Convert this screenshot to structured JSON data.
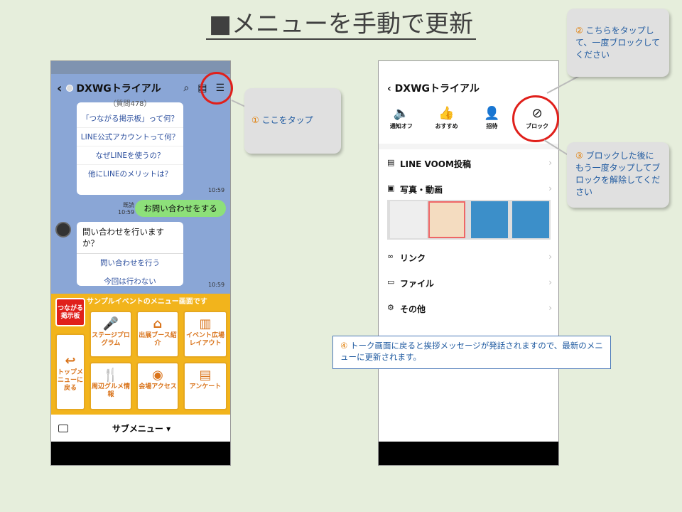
{
  "title": "■メニューを手動で更新",
  "left_phone": {
    "chat_title": "DXWGトライアル",
    "card1_cut": "（質問478）",
    "card1_items": [
      "「つながる掲示板」って何？",
      "LINE公式アカウントって何？",
      "なぜLINEを使うの？",
      "他にLINEのメリットは？"
    ],
    "time1": "10:59",
    "read_label": "既読",
    "time2": "10:59",
    "user_message": "お問い合わせをする",
    "card2_question": "問い合わせを行いますか？",
    "card2_items": [
      "問い合わせを行う",
      "今回は行わない"
    ],
    "time3": "10:59",
    "menu_header": "サンプルイベントのメニュー画面です",
    "tiles": {
      "tsunagaru": "つながる掲示板",
      "top_menu": "トップメニューに戻る",
      "stage": "ステージプログラム",
      "booth": "出展ブース紹介",
      "layout": "イベント広場レイアウト",
      "gourmet": "周辺グルメ情報",
      "access": "会場アクセス",
      "survey": "アンケート"
    },
    "submenu_label": "サブメニュー ▾"
  },
  "right_phone": {
    "chat_title": "DXWGトライアル",
    "actions": [
      {
        "icon": "speaker-icon",
        "label": "通知オフ"
      },
      {
        "icon": "thumbs-up-icon",
        "label": "おすすめ"
      },
      {
        "icon": "add-user-icon",
        "label": "招待"
      },
      {
        "icon": "block-icon",
        "label": "ブロック"
      }
    ],
    "items": {
      "voom": "LINE VOOM投稿",
      "photos": "写真・動画",
      "links": "リンク",
      "files": "ファイル",
      "other": "その他"
    }
  },
  "callouts": {
    "c1_num": "①",
    "c1_text": "ここをタップ",
    "c2_num": "②",
    "c2_text": "こちらをタップして、一度ブロックしてください",
    "c3_num": "③",
    "c3_text": "ブロックした後にもう一度タップしてブロックを解除してください",
    "c4_num": "④",
    "c4_text": "トーク画面に戻ると挨拶メッセージが発話されますので、最新のメニューに更新されます。"
  },
  "colors": {
    "accent_red": "#e0201b",
    "menu_yellow": "#f2b41c",
    "line_green": "#8de07a"
  }
}
